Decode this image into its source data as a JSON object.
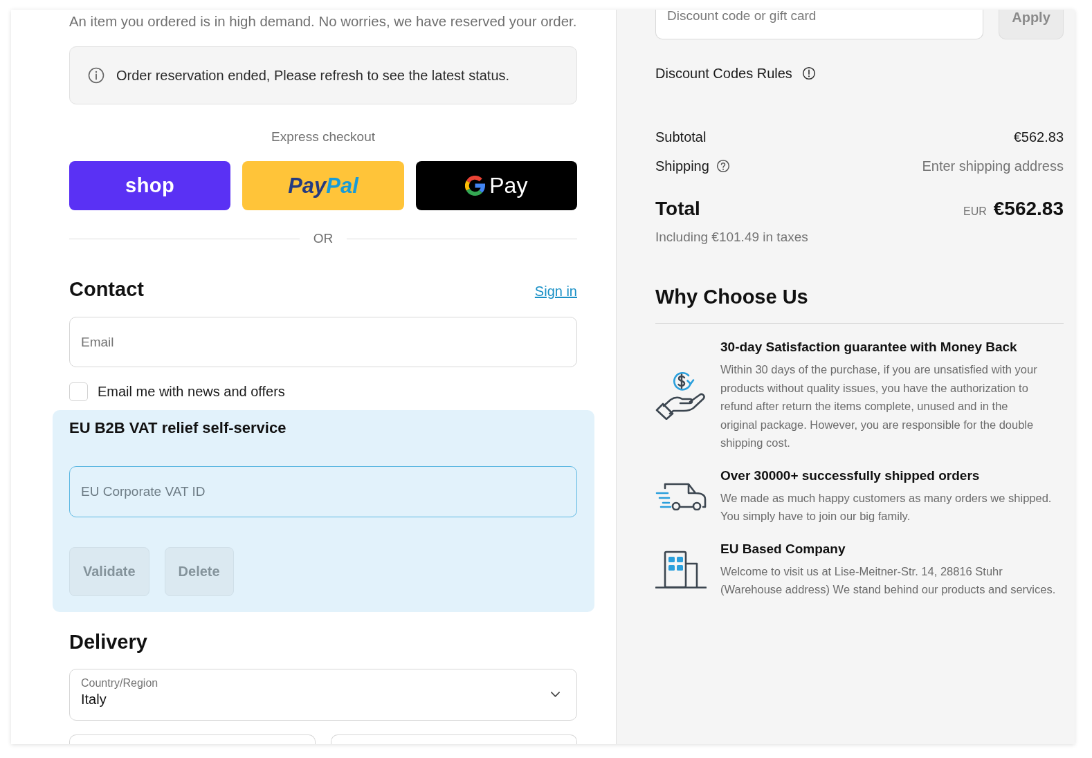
{
  "notices": {
    "demand_message": "An item you ordered is in high demand. No worries, we have reserved your order.",
    "reservation_alert": "Order reservation ended, Please refresh to see the latest status."
  },
  "express_checkout": {
    "title": "Express checkout",
    "buttons": [
      {
        "kind": "shop",
        "label": [
          "shop"
        ]
      },
      {
        "kind": "paypal",
        "label": [
          "Pay",
          "Pal"
        ]
      },
      {
        "kind": "gpay",
        "label": [
          "Pay"
        ]
      }
    ],
    "separator": "OR"
  },
  "contact": {
    "title": "Contact",
    "sign_in": "Sign in",
    "email": {
      "placeholder": "Email"
    },
    "newsletter": {
      "label": "Email me with news and offers",
      "checked": false
    }
  },
  "vat_relief": {
    "title": "EU B2B VAT relief self-service",
    "vat_id": {
      "placeholder": "EU Corporate VAT ID"
    },
    "buttons": [
      {
        "label": "Validate",
        "disabled": true
      },
      {
        "label": "Delete",
        "disabled": true
      }
    ]
  },
  "delivery": {
    "title": "Delivery",
    "country": {
      "label": "Country/Region",
      "value": "Italy"
    }
  },
  "order_summary": {
    "discount": {
      "placeholder": "Discount code or gift card",
      "apply": {
        "label": "Apply",
        "disabled": true
      }
    },
    "rules": "Discount Codes Rules",
    "lines": [
      {
        "label": "Subtotal",
        "value": "€562.83",
        "kind": "amount",
        "help": false
      },
      {
        "label": "Shipping",
        "value": "Enter shipping address",
        "kind": "pending",
        "help": true
      }
    ],
    "total": {
      "label": "Total",
      "currency": "EUR",
      "amount": "€562.83"
    },
    "taxes": "Including €101.49 in taxes"
  },
  "why_choose_us": {
    "title": "Why Choose Us",
    "features": [
      {
        "kind": "money-back",
        "title": "30-day Satisfaction guarantee with Money Back",
        "text": "Within 30 days of the purchase, if you are unsatisfied with your products without quality issues, you have the authorization to refund after return the items complete, unused and in the\noriginal package. However, you are responsible for the double shipping cost."
      },
      {
        "kind": "shipping",
        "title": "Over 30000+ successfully shipped orders",
        "text": "We made as much happy customers as many orders we shipped. You simply have to join our big family."
      },
      {
        "kind": "company",
        "title": "EU Based Company",
        "text": "Welcome to visit us at Lise-Meitner-Str. 14, 28816 Stuhr (Warehouse address) We stand behind our products and services."
      }
    ]
  }
}
